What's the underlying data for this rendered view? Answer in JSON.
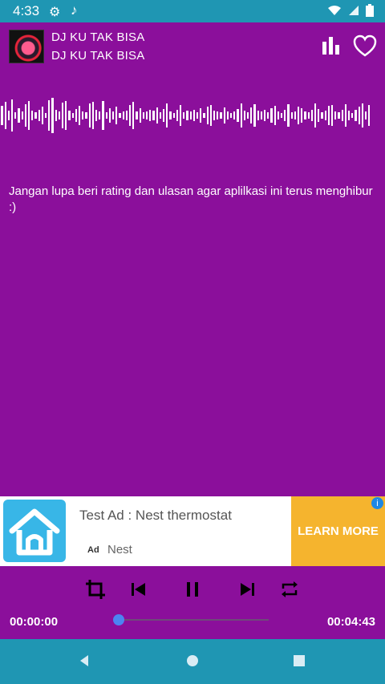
{
  "status_bar": {
    "time": "4:33"
  },
  "player": {
    "title": "DJ KU TAK BISA",
    "subtitle": "DJ KU TAK BISA"
  },
  "message": {
    "text": "Jangan lupa beri rating dan ulasan agar aplilkasi ini terus menghibur :)"
  },
  "ad": {
    "title": "Test Ad : Nest thermostat",
    "badge": "Ad",
    "brand": "Nest",
    "cta": "LEARN MORE",
    "info": "i"
  },
  "playback": {
    "current_time": "00:00:00",
    "duration": "00:04:43",
    "progress": 0.0
  },
  "colors": {
    "primary": "#8b0f9b",
    "status_bar": "#1f96b3",
    "accent": "#f5b42e"
  },
  "icons": {
    "status": [
      "settings-icon",
      "music-note-icon",
      "wifi-icon",
      "signal-icon",
      "battery-icon"
    ],
    "header": [
      "equalizer-icon",
      "heart-icon"
    ],
    "controls": [
      "crop-icon",
      "previous-icon",
      "pause-icon",
      "next-icon",
      "repeat-icon"
    ],
    "nav": [
      "back-icon",
      "home-icon",
      "recents-icon"
    ]
  }
}
